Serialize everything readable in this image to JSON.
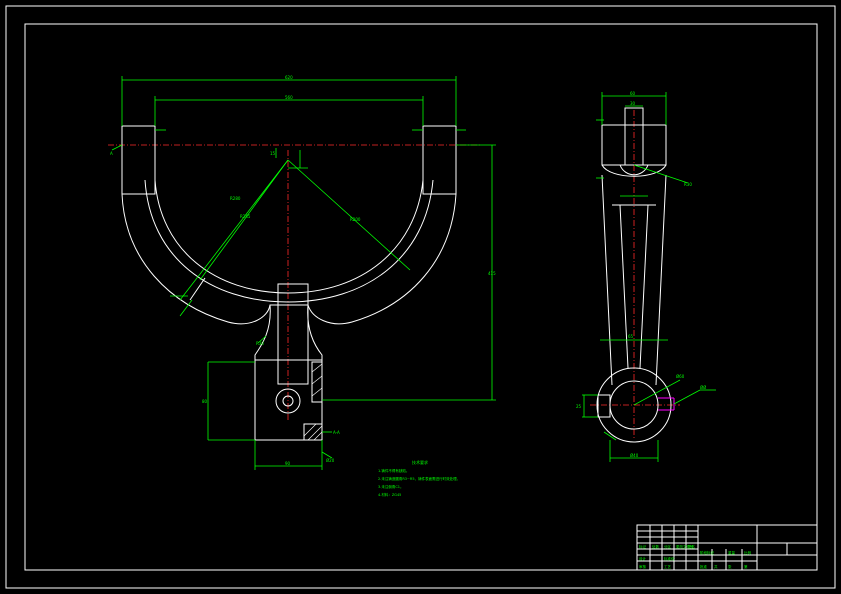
{
  "drawing": {
    "background": "#000000",
    "line_colors": {
      "outline": "#ffffff",
      "dimension": "#00ff00",
      "centerline": "#ff2a2a",
      "highlight": "#ff00ff"
    },
    "front_view": {
      "dims": {
        "overall_width": "620",
        "inner_width": "560",
        "height": "415",
        "hub_width": "90",
        "hub_height": "80",
        "radius_1": "R280",
        "radius_2": "R245",
        "radius_3": "R200",
        "offset": "15",
        "fillet": "R30",
        "bore": "Ø20"
      },
      "section_label": "A-A"
    },
    "side_view": {
      "dims": {
        "top_width": "60",
        "top_inner": "30",
        "boss_width": "65",
        "side_left": "25",
        "right_r": "R30",
        "bore": "Ø60",
        "shaft": "Ø40",
        "note": "ØØ"
      }
    },
    "technical_requirements": {
      "title": "技术要求",
      "lines": [
        "1.铸件不得有缺陷。",
        "2.未注铸造圆角R3~R5，铸件表面需进行时效处理。",
        "3.未注倒角C1。",
        "4.材料：ZG45"
      ]
    },
    "title_block": {
      "cells": [
        "标记",
        "处数",
        "分区",
        "更改文件号",
        "签名",
        "年月日",
        "设计",
        "标准化",
        "阶段标记",
        "重量",
        "比例",
        "审核",
        "工艺",
        "批准",
        "共",
        "张",
        "第",
        "张"
      ]
    }
  }
}
